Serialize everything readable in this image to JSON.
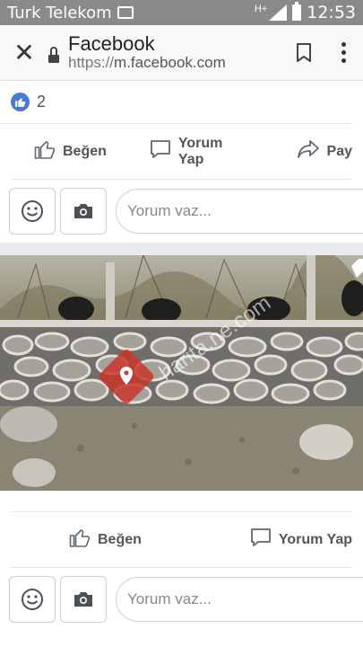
{
  "status_bar": {
    "carrier": "Turk Telekom",
    "network": "H+",
    "time": "12:53"
  },
  "browser": {
    "page_title": "Facebook",
    "url_scheme": "https://",
    "url_host": "m.facebook.com"
  },
  "post1": {
    "like_count": "2",
    "actions": {
      "like": "Beğen",
      "comment": "Yorum Yap",
      "share": "Pay"
    },
    "comment_placeholder": "Yorum vaz..."
  },
  "post2": {
    "photo_watermark": "harita.ne.com",
    "actions": {
      "like": "Beğen",
      "comment": "Yorum Yap"
    },
    "comment_placeholder": "Yorum vaz..."
  },
  "colors": {
    "status_bar": "#8a8a8a",
    "like_blue": "#4a78d8",
    "text_gray": "#555555",
    "background": "#e9ebee"
  },
  "icons": [
    "close-icon",
    "lock-icon",
    "bookmark-icon",
    "more-icon",
    "like-icon",
    "comment-icon",
    "share-icon",
    "emoji-icon",
    "camera-icon"
  ]
}
